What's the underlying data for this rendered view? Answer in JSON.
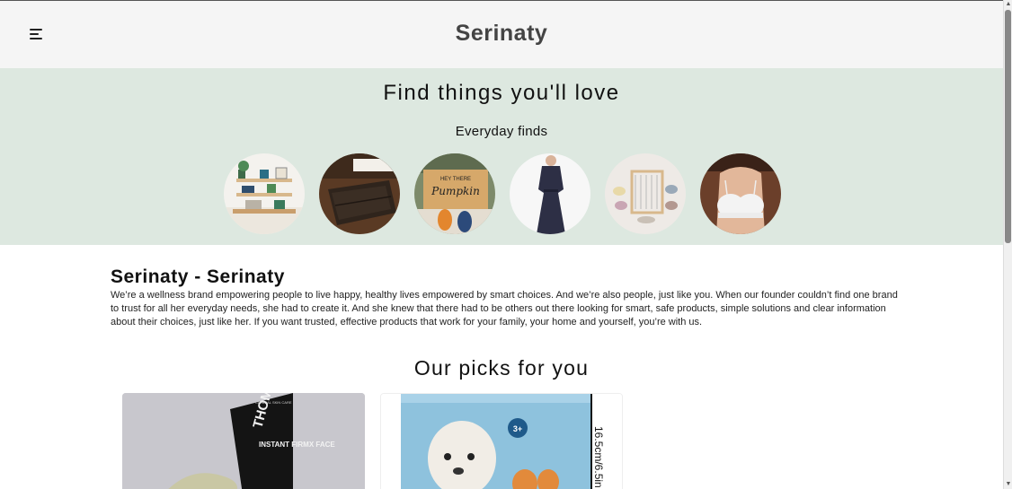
{
  "header": {
    "brand": "Serinaty",
    "menu_icon": "hamburger-menu-icon"
  },
  "hero": {
    "title": "Find things you'll love",
    "subtitle": "Everyday finds",
    "background": "#dde8e0",
    "categories": [
      {
        "image": "wall-shelf-decor"
      },
      {
        "image": "leather-wallet"
      },
      {
        "image": "hey-there-pumpkin-doormat"
      },
      {
        "image": "navy-dress"
      },
      {
        "image": "weaving-loom-kit"
      },
      {
        "image": "white-lace-bra"
      }
    ]
  },
  "about": {
    "title": "Serinaty - Serinaty",
    "text": "We’re a wellness brand empowering people to live happy, healthy lives empowered by smart choices. And we’re also people, just like you. When our founder couldn’t find one brand to trust for all her everyday needs, she had to create it. And she knew that there had to be others out there looking for smart, safe products, simple solutions and clear information about their choices, just like her. If you want trusted, effective products that work for your family, your home and yourself, you’re with us."
  },
  "picks": {
    "title": "Our picks for you",
    "products": [
      {
        "image": "thomas-roth-instant-firmx-face-tube",
        "brand_text": "THOMAS ROTH",
        "product_text": "INSTANT FIRMX FACE",
        "tag_text": "CLINICAL SKIN CARE"
      },
      {
        "image": "white-plush-puppy-toy-box",
        "size_text": "16.5cm/6.5in",
        "age_badge": "3+"
      }
    ]
  }
}
